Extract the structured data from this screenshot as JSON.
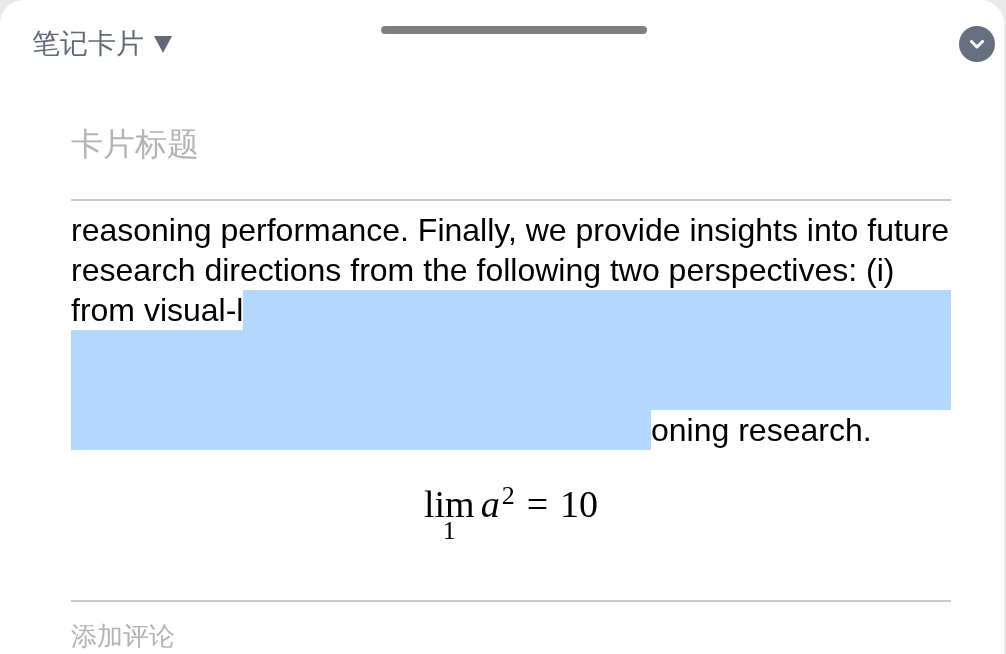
{
  "header": {
    "title": "笔记卡片"
  },
  "card_title": {
    "placeholder": "卡片标题"
  },
  "body": {
    "text_before_selection": "reasoning performance. Finally, we provide insights into future research directions from the following two perspectives: (i) from visual-l",
    "selection_highlighted": true,
    "text_after_selection": "oning research."
  },
  "formula": {
    "operator": "lim",
    "under": "1",
    "base": "a",
    "exponent": "2",
    "relation": "=",
    "value": "10"
  },
  "comment": {
    "placeholder": "添加评论"
  }
}
